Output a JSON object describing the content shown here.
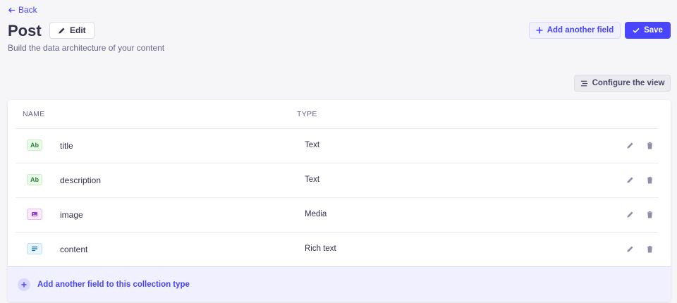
{
  "header": {
    "back_label": "Back",
    "title": "Post",
    "edit_label": "Edit",
    "subtitle": "Build the data architecture of your content",
    "add_field_label": "Add another field",
    "save_label": "Save",
    "configure_label": "Configure the view"
  },
  "table": {
    "col_name": "NAME",
    "col_type": "TYPE",
    "rows": [
      {
        "badge": "Ab",
        "badge_kind": "text",
        "name": "title",
        "type": "Text"
      },
      {
        "badge": "Ab",
        "badge_kind": "text",
        "name": "description",
        "type": "Text"
      },
      {
        "badge": "media-icon",
        "badge_kind": "media",
        "name": "image",
        "type": "Media"
      },
      {
        "badge": "richtext-icon",
        "badge_kind": "rich",
        "name": "content",
        "type": "Rich text"
      }
    ],
    "footer_label": "Add another field to this collection type"
  },
  "colors": {
    "primary": "#4945ff",
    "background": "#f6f6f9",
    "text": "#32324d",
    "muted": "#666687"
  }
}
